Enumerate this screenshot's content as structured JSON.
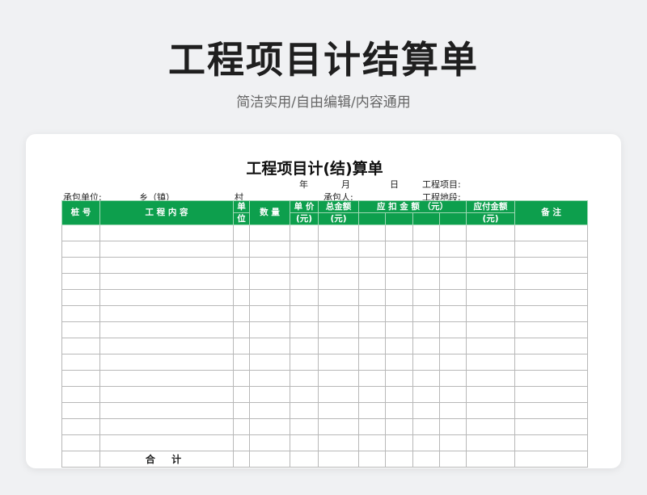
{
  "hero": {
    "title": "工程项目计结算单",
    "subtitle": "简洁实用/自由编辑/内容通用"
  },
  "sheet": {
    "title": "工程项目计(结)算单",
    "date_year": "年",
    "date_month": "月",
    "date_day": "日",
    "project_label": "工程项目:",
    "contractor_unit_label": "承包单位:",
    "township_label": "乡（镇）",
    "village_label": "村",
    "contractor_person_label": "承包人:",
    "site_label": "工程地段:",
    "headers": {
      "pile_no": "桩 号",
      "content": "工 程 内 容",
      "unit_top": "单",
      "unit_bottom": "位",
      "quantity": "数 量",
      "unit_price_top": "单 价",
      "unit_price_bottom": "(元)",
      "total_top": "总金额",
      "total_bottom": "(元)",
      "deduct": "应  扣  金  额  （元）",
      "payable_top": "应付金额",
      "payable_bottom": "(元)",
      "remarks": "备  注"
    },
    "total_label": "合 计"
  },
  "colors": {
    "header_green": "#0d9f4d",
    "background": "#f0f1f3"
  }
}
